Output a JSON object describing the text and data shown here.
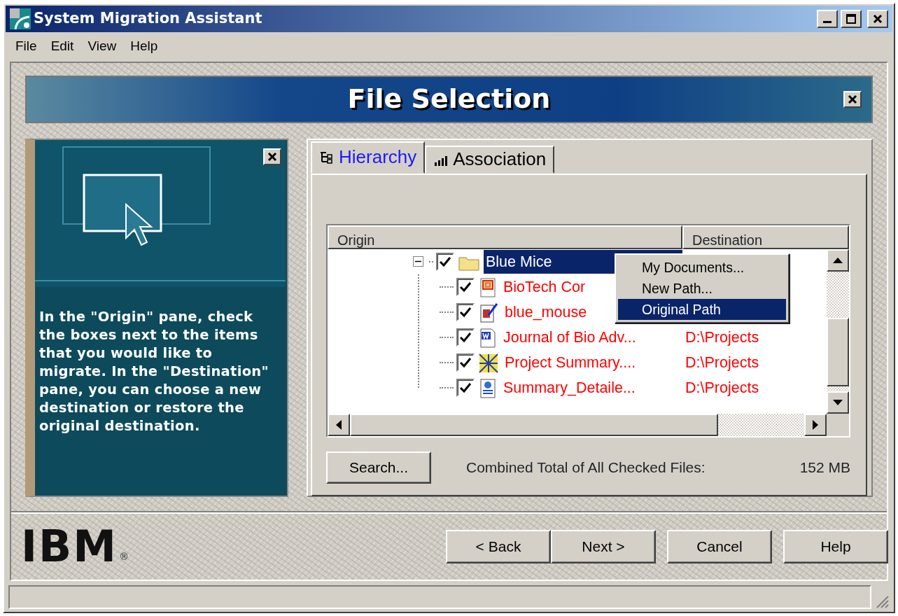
{
  "window": {
    "title": "System Migration Assistant"
  },
  "menu_bar": [
    "File",
    "Edit",
    "View",
    "Help"
  ],
  "banner": {
    "title": "File Selection"
  },
  "help_panel": {
    "text": "In the \"Origin\" pane, check the boxes next to the items that you would like to migrate.  In the \"Destination\" pane, you can choose a new destination or restore the original destination."
  },
  "tabs": [
    {
      "label": "Hierarchy",
      "selected": true,
      "kind": "tree"
    },
    {
      "label": "Association",
      "selected": false,
      "kind": "bars"
    }
  ],
  "file_list": {
    "columns": [
      "Origin",
      "Destination"
    ],
    "items": [
      {
        "name": "Blue Mice",
        "kind": "folder",
        "checked": true,
        "expanded": true,
        "selected": true,
        "children": [
          {
            "name": "BioTech Cor",
            "kind": "presentation",
            "checked": true,
            "selected": false
          },
          {
            "name": "blue_mouse",
            "kind": "drawing",
            "checked": true,
            "selected": false
          },
          {
            "name": "Journal of Bio Adv...",
            "kind": "document",
            "checked": true,
            "selected": false,
            "destination": "D:\\Projects"
          },
          {
            "name": "Project Summary....",
            "kind": "chart",
            "checked": true,
            "selected": false,
            "destination": "D:\\Projects"
          },
          {
            "name": "Summary_Detaile...",
            "kind": "webpage",
            "checked": true,
            "selected": false,
            "destination": "D:\\Projects"
          }
        ]
      }
    ]
  },
  "context_menu": {
    "items": [
      {
        "label": "My Documents...",
        "selected": false
      },
      {
        "label": "New Path...",
        "selected": false
      },
      {
        "label": "Original Path",
        "selected": true
      }
    ]
  },
  "search_button": "Search...",
  "total": {
    "label": "Combined Total of All Checked Files:",
    "value": "152 MB"
  },
  "logo": {
    "text": "IBM",
    "mark": "®"
  },
  "buttons": [
    "< Back",
    "Next >",
    "Cancel",
    "Help"
  ]
}
